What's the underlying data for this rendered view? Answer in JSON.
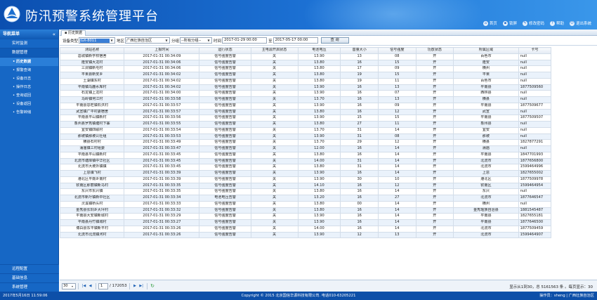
{
  "app": {
    "title": "防汛预警系统管理平台"
  },
  "topnav": [
    {
      "icon": "home-icon",
      "glyph": "⌂",
      "label": "首页"
    },
    {
      "icon": "lock-icon",
      "glyph": "▪",
      "label": "锁屏"
    },
    {
      "icon": "key-icon",
      "glyph": "✎",
      "label": "修改密码"
    },
    {
      "icon": "help-icon",
      "glyph": "?",
      "label": "帮助"
    },
    {
      "icon": "power-icon",
      "glyph": "⏻",
      "label": "退出系统"
    }
  ],
  "sidebar": {
    "header": "导航菜单",
    "collapse_glyph": "«",
    "groups": [
      {
        "label": "实时监测",
        "open": false,
        "items": []
      },
      {
        "label": "数据管理",
        "open": true,
        "items": [
          {
            "label": "历史数据",
            "active": true
          },
          {
            "label": "报警查询",
            "active": false
          },
          {
            "label": "设备日志",
            "active": false
          },
          {
            "label": "操作日志",
            "active": false
          },
          {
            "label": "查询返回",
            "active": false
          },
          {
            "label": "设备返回",
            "active": false
          },
          {
            "label": "告警转储",
            "active": false
          }
        ]
      }
    ],
    "bottom_groups": [
      {
        "label": "远程配置"
      },
      {
        "label": "基础信息"
      },
      {
        "label": "系统管理"
      }
    ]
  },
  "tabs": [
    {
      "label": "历史数据"
    }
  ],
  "filters": {
    "device_type_label": "设备类型",
    "device_type_value": "GX-8011",
    "region_label": "地区",
    "region_value": "广西壮族自治区",
    "group_label": "分组",
    "group_value": "--所有分组--",
    "time_label": "时间",
    "start_time": "2017-01-29 00:00",
    "to_label": "至",
    "end_time": "2017-05-17 00:00",
    "query_label": "查 询"
  },
  "table": {
    "columns": [
      "测站名称",
      "上报时间",
      "运行状态",
      "主电源开启状态",
      "电池电压",
      "音量大小",
      "信号强度",
      "功放状态",
      "所属区域",
      "卡号"
    ],
    "rows": [
      [
        "邕城镇新学校宿舍",
        "2017-01-31 00:34:09",
        "信号强度告警",
        "关",
        "13.90",
        "13",
        "08",
        "开",
        "百色市",
        "null"
      ],
      [
        "隆安镇大龙村",
        "2017-01-31 00:34:06",
        "信号强度告警",
        "关",
        "13.80",
        "16",
        "15",
        "开",
        "隆安",
        "null"
      ],
      [
        "三洞镇新屯村",
        "2017-01-31 00:34:06",
        "信号强度告警",
        "关",
        "13.80",
        "17",
        "09",
        "开",
        "横州",
        "null"
      ],
      [
        "平果县新安乡",
        "2017-01-31 00:34:02",
        "信号强度告警",
        "关",
        "13.80",
        "19",
        "15",
        "开",
        "平果",
        "null"
      ],
      [
        "土湖镇东村",
        "2017-01-31 00:34:02",
        "信号强度告警",
        "关",
        "13.80",
        "19",
        "11",
        "开",
        "百色市",
        "null"
      ],
      [
        "平南镇马鹿水库村",
        "2017-01-31 00:34:02",
        "信号强度告警",
        "关",
        "13.90",
        "16",
        "13",
        "开",
        "平南县",
        "1877509560"
      ],
      [
        "石龙镇上龙村",
        "2017-01-31 00:34:00",
        "信号强度告警",
        "关",
        "13.90",
        "16",
        "07",
        "开",
        "西林县",
        "null"
      ],
      [
        "马岭镇何江村",
        "2017-01-31 00:33:58",
        "信号强度告警",
        "关",
        "13.70",
        "16",
        "13",
        "开",
        "横县",
        "null"
      ],
      [
        "平南县思旺镇石洪村",
        "2017-01-31 00:33:57",
        "信号强度告警",
        "关",
        "13.90",
        "16",
        "09",
        "开",
        "平南县",
        "1877509677"
      ],
      [
        "武宣镇广平村委宿舍",
        "2017-01-31 00:33:57",
        "信号强度告警",
        "关",
        "13.80",
        "16",
        "12",
        "开",
        "武宣",
        "null"
      ],
      [
        "平南县平山镇新村",
        "2017-01-31 00:33:56",
        "信号强度告警",
        "关",
        "13.90",
        "15",
        "15",
        "开",
        "平南县",
        "1877509507"
      ],
      [
        "象州县罗秀镇塘村下寨",
        "2017-01-31 00:33:55",
        "信号强度告警",
        "关",
        "13.80",
        "27",
        "11",
        "开",
        "象州县",
        "null"
      ],
      [
        "宜安镇四联村",
        "2017-01-31 00:33:54",
        "信号强度告警",
        "关",
        "13.70",
        "31",
        "14",
        "开",
        "宜安",
        "null"
      ],
      [
        "那坡镇那坡公社组",
        "2017-01-31 00:33:53",
        "信号强度告警",
        "关",
        "13.90",
        "31",
        "08",
        "开",
        "那坡",
        "null"
      ],
      [
        "横县石村村",
        "2017-01-31 00:33:49",
        "信号强度告警",
        "关",
        "13.70",
        "29",
        "12",
        "开",
        "横县",
        "1827877291"
      ],
      [
        "蒲庙镇三村组委",
        "2017-01-31 00:33:47",
        "信号强度告警",
        "关",
        "12.00",
        "16",
        "14",
        "开",
        "蒲庙",
        "null"
      ],
      [
        "平南县平山镇新村",
        "2017-01-31 00:33:45",
        "信号强度告警",
        "关",
        "13.80",
        "16",
        "14",
        "开",
        "平南县",
        "1847701993"
      ],
      [
        "北流市塘岸镇中华社区",
        "2017-01-31 00:33:45",
        "信号强度告警",
        "关",
        "14.00",
        "31",
        "14",
        "开",
        "北流市",
        "1877656800"
      ],
      [
        "北流市大坡外镇镇",
        "2017-01-31 00:33:45",
        "信号强度告警",
        "关",
        "13.80",
        "31",
        "14",
        "开",
        "北流市",
        "1599464996"
      ],
      [
        "上思镇飞村",
        "2017-01-31 00:33:39",
        "信号强度告警",
        "关",
        "13.90",
        "16",
        "14",
        "开",
        "上思",
        "1827655002"
      ],
      [
        "港北区平南乡南村",
        "2017-01-31 00:33:39",
        "信号强度告警",
        "关",
        "13.90",
        "30",
        "10",
        "开",
        "港北区",
        "1877509978"
      ],
      [
        "钦南区那丽镇新马村",
        "2017-01-31 00:33:35",
        "信号强度告警",
        "关",
        "14.10",
        "16",
        "12",
        "开",
        "钦南区",
        "1599464954"
      ],
      [
        "东兴市东兴镇",
        "2017-01-31 00:33:35",
        "信号强度告警",
        "关",
        "13.80",
        "16",
        "14",
        "开",
        "东兴",
        "null"
      ],
      [
        "北流市新圩镇新中社区",
        "2017-01-31 00:33:34",
        "电池电压告警",
        "关",
        "13.20",
        "16",
        "27",
        "开",
        "北流市",
        "1877646547"
      ],
      [
        "灵溪镇桥头村",
        "2017-01-31 00:33:33",
        "信号强度告警",
        "关",
        "13.80",
        "00",
        "14",
        "开",
        "横州",
        "null"
      ],
      [
        "金秀县长垌乡大坪村",
        "2017-01-31 00:33:32",
        "信号强度告警",
        "关",
        "13.80",
        "16",
        "14",
        "开",
        "金秀瑶族自治县",
        "1881545487"
      ],
      [
        "平南县大安镇新城村",
        "2017-01-31 00:33:29",
        "信号强度告警",
        "关",
        "13.90",
        "16",
        "14",
        "开",
        "平南县",
        "1827655181"
      ],
      [
        "平南县丹竹镇城村",
        "2017-01-31 00:33:27",
        "信号强度告警",
        "关",
        "13.90",
        "16",
        "14",
        "开",
        "平南县",
        "1877646500"
      ],
      [
        "博白县东平镇新平村",
        "2017-01-31 00:33:26",
        "信号强度告警",
        "关",
        "14.00",
        "16",
        "14",
        "开",
        "北流市",
        "1877509459"
      ],
      [
        "北流市北流镇河村",
        "2017-01-31 00:33:26",
        "信号强度告警",
        "关",
        "13.90",
        "12",
        "13",
        "开",
        "北流市",
        "1599464907"
      ]
    ]
  },
  "pager": {
    "page_size": "30",
    "page_size_arrow": "▾",
    "first_glyph": "|◀",
    "prev_glyph": "◀",
    "page": "1",
    "total_pages": "/ 172053",
    "next_glyph": "▶",
    "last_glyph": "▶|",
    "refresh_glyph": "↻",
    "summary": "显示从1到30，总 5161563 条 。每页显示：30"
  },
  "footer": {
    "time": "2017年5月16日 11:59:06",
    "copyright": "Copyright © 2015 北京国信华源科技有限公司. 电话010-63205221",
    "user": "操作员：sheng | 广西壮族自治区"
  },
  "colors": {
    "header": "#1a6ad0",
    "sidebar": "#1667c5",
    "footer": "#0d4fa8",
    "row_alt": "#eaf2fb"
  }
}
